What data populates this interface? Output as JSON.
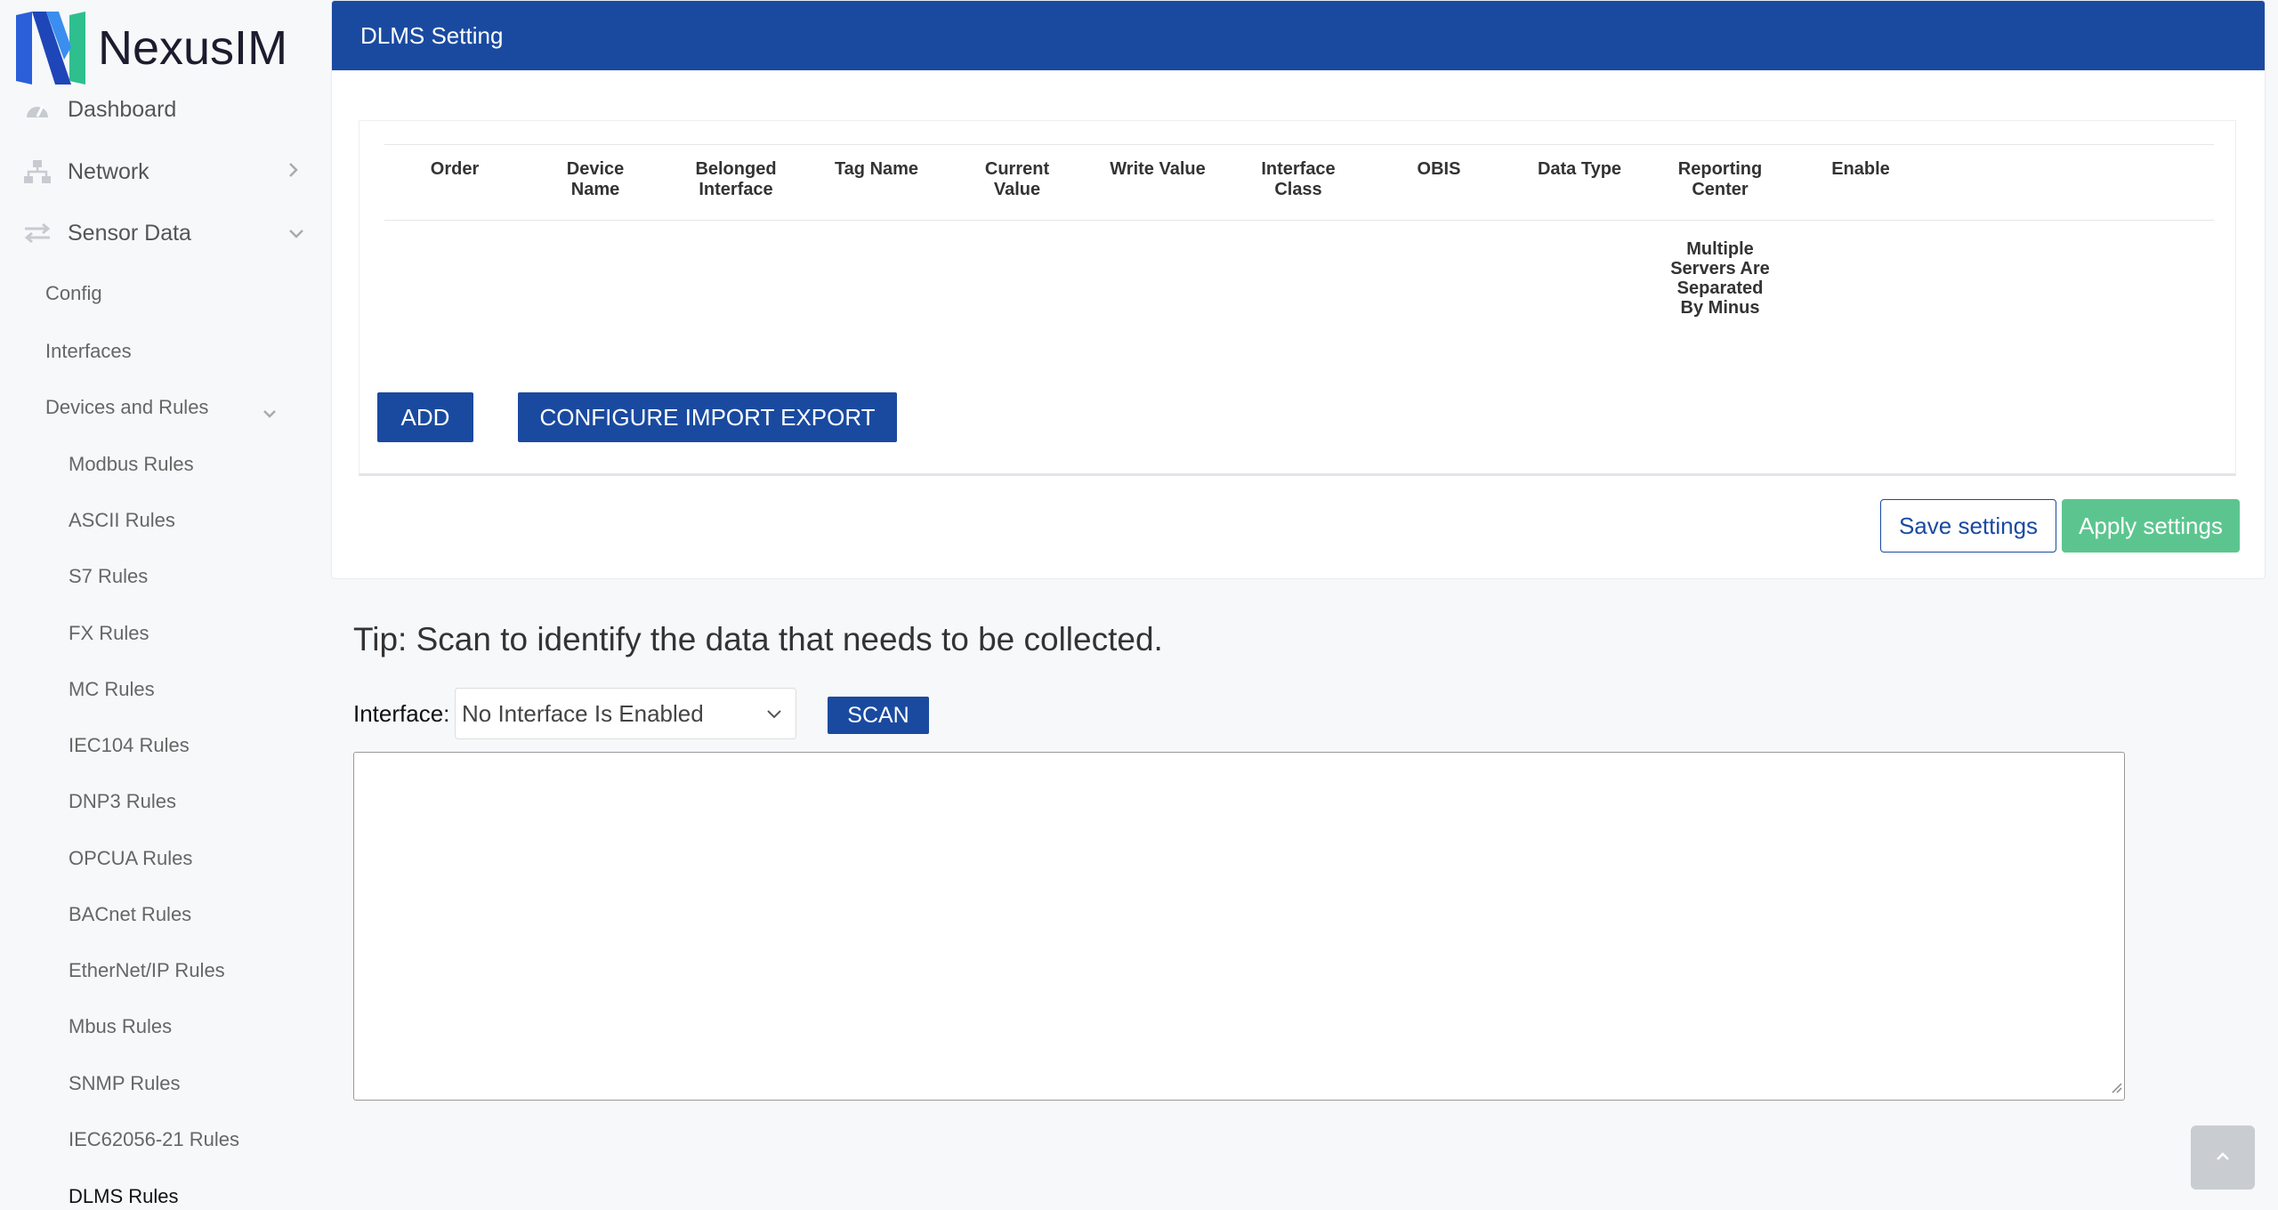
{
  "brand": {
    "name": "NexusIM"
  },
  "sidebar": {
    "top": [
      {
        "label": "Dashboard",
        "icon": "dashboard-icon"
      },
      {
        "label": "Network",
        "icon": "network-icon"
      },
      {
        "label": "Sensor Data",
        "icon": "transfer-icon"
      }
    ],
    "sub": [
      {
        "label": "Config"
      },
      {
        "label": "Interfaces"
      },
      {
        "label": "Devices and Rules"
      }
    ],
    "rules": [
      {
        "label": "Modbus Rules"
      },
      {
        "label": "ASCII Rules"
      },
      {
        "label": "S7 Rules"
      },
      {
        "label": "FX Rules"
      },
      {
        "label": "MC Rules"
      },
      {
        "label": "IEC104 Rules"
      },
      {
        "label": "DNP3 Rules"
      },
      {
        "label": "OPCUA Rules"
      },
      {
        "label": "BACnet Rules"
      },
      {
        "label": "EtherNet/IP Rules"
      },
      {
        "label": "Mbus Rules"
      },
      {
        "label": "SNMP Rules"
      },
      {
        "label": "IEC62056-21 Rules"
      },
      {
        "label": "DLMS Rules"
      }
    ]
  },
  "panel": {
    "title": "DLMS Setting",
    "columns": [
      {
        "l1": "Order",
        "l2": ""
      },
      {
        "l1": "Device",
        "l2": "Name"
      },
      {
        "l1": "Belonged",
        "l2": "Interface"
      },
      {
        "l1": "Tag Name",
        "l2": ""
      },
      {
        "l1": "Current",
        "l2": "Value"
      },
      {
        "l1": "Write Value",
        "l2": ""
      },
      {
        "l1": "Interface",
        "l2": "Class"
      },
      {
        "l1": "OBIS",
        "l2": ""
      },
      {
        "l1": "Data Type",
        "l2": ""
      },
      {
        "l1": "Reporting",
        "l2": "Center"
      },
      {
        "l1": "Enable",
        "l2": ""
      }
    ],
    "reporting_note": [
      "Multiple",
      "Servers Are",
      "Separated",
      "By Minus"
    ],
    "add_label": "ADD",
    "import_label": "CONFIGURE IMPORT EXPORT",
    "save_label": "Save settings",
    "apply_label": "Apply settings"
  },
  "scan": {
    "tip": "Tip: Scan to identify the data that needs to be collected.",
    "interface_label": "Interface:",
    "interface_value": "No Interface Is Enabled",
    "scan_label": "SCAN",
    "output": ""
  },
  "colors": {
    "primary": "#1a4aa0",
    "apply": "#5cc58f"
  }
}
